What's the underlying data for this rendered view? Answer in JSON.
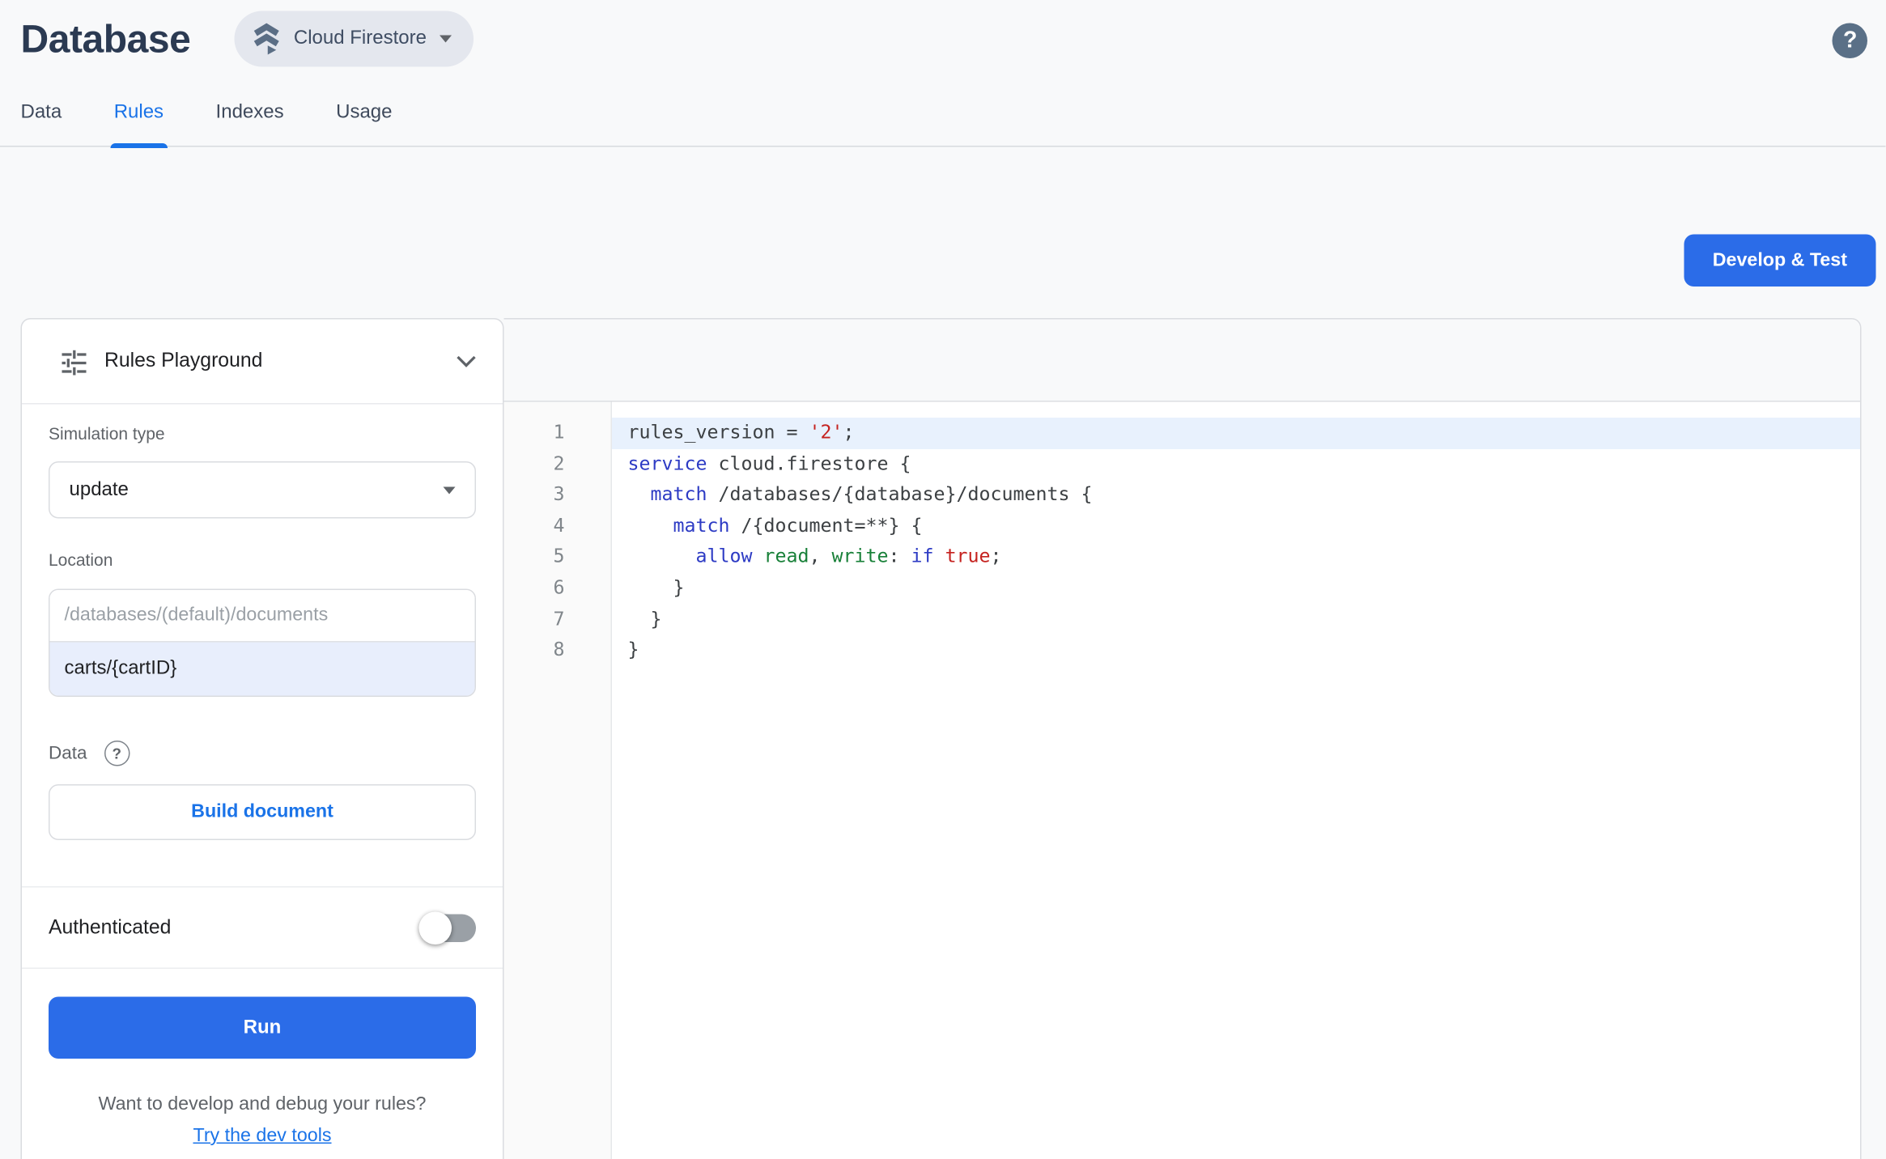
{
  "header": {
    "title": "Database",
    "product_switcher_label": "Cloud Firestore",
    "help_icon": "help-icon"
  },
  "tabs": [
    {
      "label": "Data",
      "active": false
    },
    {
      "label": "Rules",
      "active": true
    },
    {
      "label": "Indexes",
      "active": false
    },
    {
      "label": "Usage",
      "active": false
    }
  ],
  "actions": {
    "develop_test_label": "Develop & Test"
  },
  "playground": {
    "title": "Rules Playground",
    "icons": [
      "tune-icon",
      "chevron-down-icon"
    ],
    "simulation_type": {
      "label": "Simulation type",
      "value": "update"
    },
    "location": {
      "label": "Location",
      "placeholder": "/databases/(default)/documents",
      "value": "carts/{cartID}"
    },
    "data_section": {
      "label": "Data",
      "help_icon": "help-circle-icon",
      "build_button_label": "Build document"
    },
    "authenticated": {
      "label": "Authenticated",
      "enabled": false
    },
    "run_button_label": "Run",
    "footer": {
      "question": "Want to develop and debug your rules?",
      "link_label": "Try the dev tools"
    }
  },
  "editor": {
    "active_line": 1,
    "lines": [
      {
        "num": 1,
        "tokens": [
          {
            "type": "plain",
            "text": "rules_version = "
          },
          {
            "type": "str",
            "text": "'2'"
          },
          {
            "type": "plain",
            "text": ";"
          }
        ]
      },
      {
        "num": 2,
        "tokens": [
          {
            "type": "kw",
            "text": "service"
          },
          {
            "type": "plain",
            "text": " cloud.firestore {"
          }
        ]
      },
      {
        "num": 3,
        "tokens": [
          {
            "type": "plain",
            "text": "  "
          },
          {
            "type": "kw",
            "text": "match"
          },
          {
            "type": "plain",
            "text": " /databases/{database}/documents {"
          }
        ]
      },
      {
        "num": 4,
        "tokens": [
          {
            "type": "plain",
            "text": "    "
          },
          {
            "type": "kw",
            "text": "match"
          },
          {
            "type": "plain",
            "text": " /{document=**} {"
          }
        ]
      },
      {
        "num": 5,
        "tokens": [
          {
            "type": "plain",
            "text": "      "
          },
          {
            "type": "kw",
            "text": "allow"
          },
          {
            "type": "plain",
            "text": " "
          },
          {
            "type": "id",
            "text": "read"
          },
          {
            "type": "plain",
            "text": ", "
          },
          {
            "type": "id",
            "text": "write"
          },
          {
            "type": "plain",
            "text": ": "
          },
          {
            "type": "kw",
            "text": "if"
          },
          {
            "type": "plain",
            "text": " "
          },
          {
            "type": "str",
            "text": "true"
          },
          {
            "type": "plain",
            "text": ";"
          }
        ]
      },
      {
        "num": 6,
        "tokens": [
          {
            "type": "plain",
            "text": "    }"
          }
        ]
      },
      {
        "num": 7,
        "tokens": [
          {
            "type": "plain",
            "text": "  }"
          }
        ]
      },
      {
        "num": 8,
        "tokens": [
          {
            "type": "plain",
            "text": "}"
          }
        ]
      }
    ]
  },
  "colors": {
    "accent_blue": "#1a73e8",
    "button_blue": "#2b6ce8",
    "keyword": "#2d3bc4",
    "string_red": "#c5221f",
    "ident_green": "#188038",
    "active_line_bg": "#e8f1fd",
    "location_value_bg": "#e8eefc",
    "page_bg": "#f8f9fa"
  }
}
